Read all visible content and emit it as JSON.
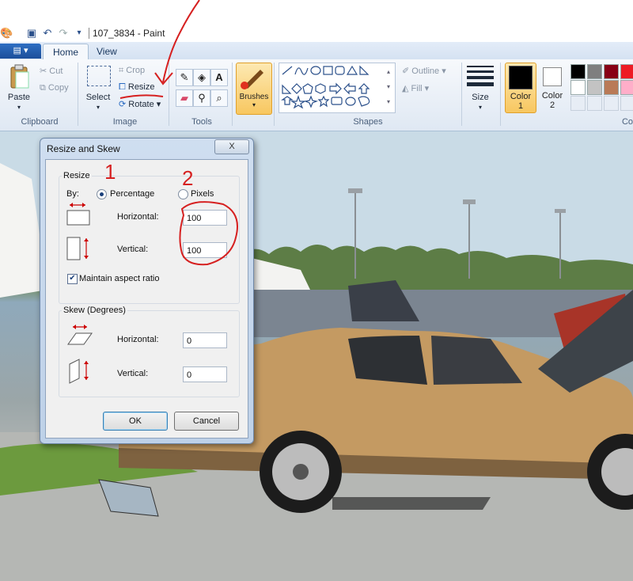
{
  "window": {
    "title": "107_3834 - Paint"
  },
  "tabs": {
    "file": "▤ ▾",
    "home": "Home",
    "view": "View"
  },
  "ribbon": {
    "clipboard": {
      "paste": "Paste",
      "cut": "Cut",
      "copy": "Copy",
      "group": "Clipboard"
    },
    "image": {
      "select": "Select",
      "crop": "Crop",
      "resize": "Resize",
      "rotate": "Rotate",
      "group": "Image"
    },
    "tools": {
      "group": "Tools"
    },
    "brushes": "Brushes",
    "shapes": {
      "outline": "Outline",
      "fill": "Fill",
      "group": "Shapes"
    },
    "size": "Size",
    "color1": {
      "line1": "Color",
      "line2": "1"
    },
    "color2": {
      "line1": "Color",
      "line2": "2"
    },
    "colors_group": "Co",
    "palette": [
      "#000000",
      "#7f7f7f",
      "#880015",
      "#ed1c24",
      "#ffffff",
      "#c3c3c3",
      "#b97a57",
      "#ffaec9"
    ]
  },
  "dialog": {
    "title": "Resize and Skew",
    "close": "X",
    "resize": {
      "legend": "Resize",
      "by_label": "By:",
      "percentage": "Percentage",
      "pixels": "Pixels",
      "horizontal_label": "Horizontal:",
      "horizontal_value": "100",
      "vertical_label": "Vertical:",
      "vertical_value": "100",
      "maintain": "Maintain aspect ratio"
    },
    "skew": {
      "legend": "Skew (Degrees)",
      "horizontal_label": "Horizontal:",
      "horizontal_value": "0",
      "vertical_label": "Vertical:",
      "vertical_value": "0"
    },
    "ok": "OK",
    "cancel": "Cancel"
  },
  "annotations": {
    "mark1": "1",
    "mark2": "2"
  }
}
